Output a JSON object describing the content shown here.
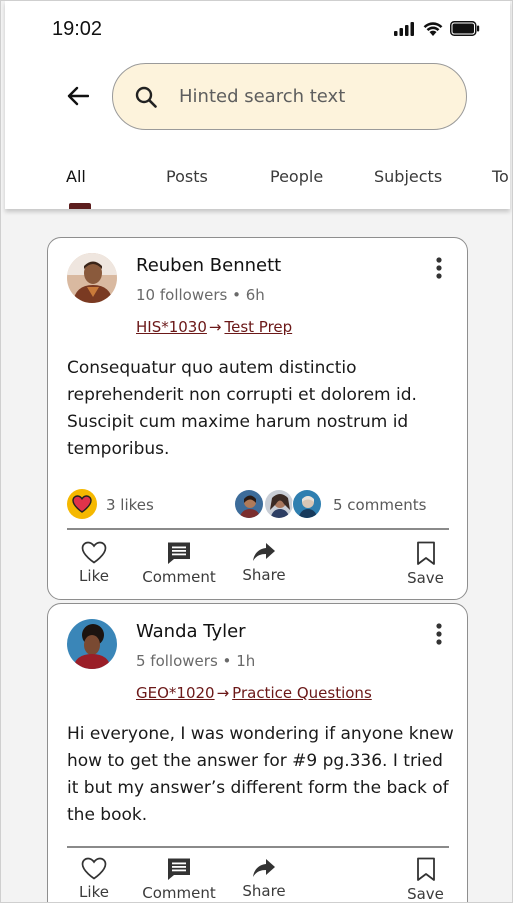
{
  "status_bar": {
    "time": "19:02",
    "icons": [
      "signal-icon",
      "wifi-icon",
      "battery-icon"
    ]
  },
  "search": {
    "placeholder": "Hinted search text",
    "value": ""
  },
  "tabs": [
    {
      "label": "All",
      "active": true
    },
    {
      "label": "Posts",
      "active": false
    },
    {
      "label": "People",
      "active": false
    },
    {
      "label": "Subjects",
      "active": false
    },
    {
      "label": "To",
      "active": false
    }
  ],
  "posts": [
    {
      "author": "Reuben Bennett",
      "followers": "10 followers",
      "time": "6h",
      "course": "HIS*1030",
      "arrow": "→",
      "topic": "Test Prep",
      "body": "Consequatur quo autem distinctio reprehenderit non corrupti et dolorem id. Suscipit cum maxime harum nostrum id temporibus.",
      "likes": "3 likes",
      "comments": "5 comments",
      "actions": {
        "like": "Like",
        "comment": "Comment",
        "share": "Share",
        "save": "Save"
      }
    },
    {
      "author": "Wanda Tyler",
      "followers": "5 followers",
      "time": "1h",
      "course": "GEO*1020",
      "arrow": "→",
      "topic": "Practice Questions",
      "body": "Hi everyone, I was wondering if anyone knew how to get the answer for #9 pg.336. I tried it but my answer’s different form the back of the book.",
      "actions": {
        "like": "Like",
        "comment": "Comment",
        "share": "Share",
        "save": "Save"
      }
    }
  ],
  "meta_separator": "•",
  "colors": {
    "search_bg": "#fdf3dc",
    "tag_link": "#6b1818",
    "tab_indicator": "#5c1d1d",
    "like_badge": "#f5b800",
    "heart": "#e0334a"
  }
}
